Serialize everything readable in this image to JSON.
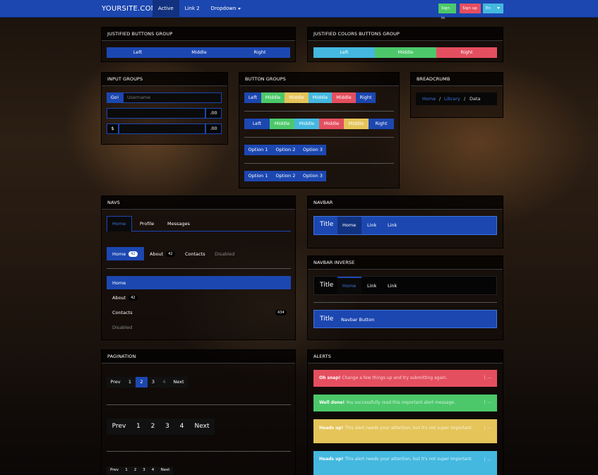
{
  "navbar": {
    "brand": "YOURSITE.COM",
    "items": [
      {
        "label": "Active"
      },
      {
        "label": "Link 2"
      },
      {
        "label": "Dropdown"
      }
    ],
    "sign_in": "Sign in",
    "sign_up": "Sign up",
    "lang": "En"
  },
  "justified": {
    "title": "JUSTIFIED BUTTONS GROUP",
    "left": "Left",
    "middle": "Middle",
    "right": "Right"
  },
  "justified_colors": {
    "title": "JUSTIFIED COLORS BUTTONS GROUP",
    "left": "Left",
    "middle": "Middle",
    "right": "Right"
  },
  "input_groups": {
    "title": "INPUT GROUPS",
    "go": "Go!",
    "username_placeholder": "Username",
    "decimal": ".00",
    "dollar": "$"
  },
  "button_groups": {
    "title": "BUTTON GROUPS",
    "row1": [
      "Left",
      "Middle",
      "Middle",
      "Middle",
      "Middle",
      "Right"
    ],
    "row2": [
      "Left",
      "Middle",
      "Middle",
      "Middle",
      "Middle",
      "Right"
    ],
    "options": [
      "Option 1",
      "Option 2",
      "Option 3"
    ]
  },
  "breadcrumb": {
    "title": "BREADCRUMB",
    "home": "Home",
    "library": "Library",
    "data": "Data",
    "sep": "/"
  },
  "navs": {
    "title": "NAVS",
    "tabs": [
      "Home",
      "Profile",
      "Messages"
    ],
    "pills": [
      {
        "label": "Home",
        "badge": "42"
      },
      {
        "label": "About",
        "badge": "42"
      },
      {
        "label": "Contacts"
      },
      {
        "label": "Disabled"
      }
    ],
    "stacked": [
      {
        "label": "Home"
      },
      {
        "label": "About",
        "badge": "42"
      },
      {
        "label": "Contacts",
        "badge": "434"
      },
      {
        "label": "Disabled"
      }
    ]
  },
  "navbar_panel": {
    "title": "NAVBAR",
    "brand": "Title",
    "home": "Home",
    "link1": "Link",
    "link2": "Link"
  },
  "navbar_inverse": {
    "title": "NAVBAR INVERSE",
    "brand": "Title",
    "home": "Home",
    "link1": "Link",
    "link2": "Link",
    "brand2": "Title",
    "button": "Navbar Button"
  },
  "pagination": {
    "title": "PAGINATION",
    "prev": "Prev",
    "next": "Next",
    "pages": [
      "1",
      "2",
      "3",
      "4"
    ]
  },
  "alerts": {
    "title": "ALERTS",
    "close": "[ —",
    "danger": {
      "strong": "Oh snap!",
      "text": "Change a few things up and try submitting again."
    },
    "success": {
      "strong": "Well done!",
      "text": "You successfully read this important alert message."
    },
    "warning": {
      "strong": "Heads up!",
      "text": "This alert needs your attention, but it's not super important."
    },
    "info": {
      "strong": "Heads up!",
      "text": "This alert needs your attention, but it's not super important."
    }
  }
}
